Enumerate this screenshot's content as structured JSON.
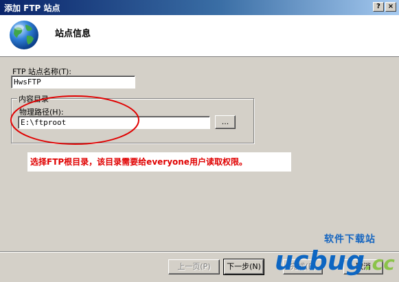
{
  "window": {
    "title": "添加 FTP 站点",
    "help_btn": "?",
    "close_btn": "×"
  },
  "header": {
    "title": "站点信息",
    "icon": "globe-icon"
  },
  "site_name": {
    "label": "FTP 站点名称(T):",
    "value": "HwsFTP"
  },
  "content_dir": {
    "group_label": "内容目录",
    "path_label": "物理路径(H):",
    "path_value": "E:\\ftproot",
    "browse_label": "..."
  },
  "annotation": {
    "text": "选择FTP根目录，该目录需要给everyone用户读取权限。",
    "color": "#e00000"
  },
  "buttons": {
    "prev": "上一页(P)",
    "next": "下一步(N)",
    "finish": "完成(F)",
    "cancel": "取消"
  },
  "watermark": {
    "cn": "软件下载站",
    "en_main": "ucbug",
    "en_suffix": ".cc"
  }
}
